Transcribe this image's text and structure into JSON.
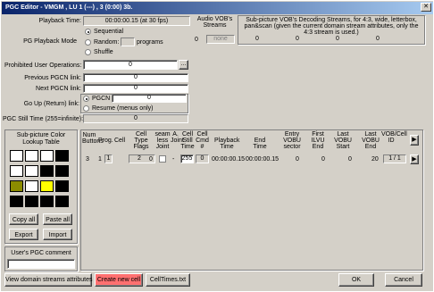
{
  "window": {
    "title": "PGC Editor - VMGM , LU 1 (---) , 3 (0:00) 3b."
  },
  "playback": {
    "label": "Playback Time:",
    "value": "00:00:00.15 (at 30 fps)"
  },
  "pg_mode": {
    "label": "PG Playback Mode",
    "options": [
      "Sequential",
      "Random:",
      "Shuffle"
    ],
    "selected": "Sequential",
    "programs_value": "",
    "programs_label": "programs"
  },
  "prohibited": {
    "label": "Prohibited User Operations:",
    "value": "0",
    "button": "..."
  },
  "prev_pgcn": {
    "label": "Previous PGCN link:",
    "value": "0"
  },
  "next_pgcn": {
    "label": "Next PGCN link:",
    "value": "0"
  },
  "goup": {
    "label": "Go Up (Return) link:",
    "options": [
      "PGCN",
      "Resume (menus only)"
    ],
    "pgcn_value": "0",
    "resume_value": "0"
  },
  "still": {
    "label": "PGC Still Time (255=infinite):",
    "value": "0"
  },
  "audio": {
    "label": "Audio VOB's Streams",
    "num": "0",
    "value": "none"
  },
  "subpic": {
    "label": "Sub-picture VOB's Decoding Streams, for 4:3, wide, letterbox, pan&scan (given the current domain stream attributes, only the 4:3 stream is used.)",
    "values": [
      "0",
      "0",
      "0",
      "0"
    ]
  },
  "clut": {
    "label": "Sub-picture Color Lookup Table",
    "colors": [
      "#ffffff",
      "#ffffff",
      "#ffffff",
      "#000000",
      "#ffffff",
      "#ffffff",
      "#000000",
      "#000000",
      "#8c8c00",
      "#ffffff",
      "#ffff00",
      "#000000",
      "#000000",
      "#000000",
      "#000000",
      "#000000"
    ],
    "copy": "Copy all",
    "paste": "Paste all",
    "export": "Export",
    "import": "Import"
  },
  "comment": {
    "label": "User's PGC comment",
    "value": ""
  },
  "cells": {
    "headers": [
      "Num Buttons",
      "Prog.",
      "Cell",
      "Cell Type Flags",
      "seam less Joint",
      "A. Joint",
      "Cell Still Time",
      "Cell Cmd #",
      "Playback Time",
      "End Time",
      "Entry VOBU sector",
      "First ILVU End",
      "Last VOBU Start",
      "Last VOBU End",
      "VOB/Cell ID"
    ],
    "row": {
      "buttons": "3",
      "prog": "1",
      "cell": "1",
      "flags": "2",
      "flags_suffix": "0",
      "a_joint": "-",
      "still": "255",
      "cmd": "0",
      "playback": "00:00:00.15",
      "end": "00:00:00.15",
      "entry": "0",
      "first_ilvu": "0",
      "last_start": "0",
      "last_end": "20",
      "vob_cell": "1 / 1"
    }
  },
  "footer": {
    "view_attrs": "View domain streams attributes",
    "create_cell": "Create new cell",
    "celltimes": "CellTimes.txt",
    "ok": "OK",
    "cancel": "Cancel"
  },
  "colors": {
    "title_start": "#0a246a",
    "title_end": "#a6caf0",
    "create_btn": "#ff7070"
  }
}
